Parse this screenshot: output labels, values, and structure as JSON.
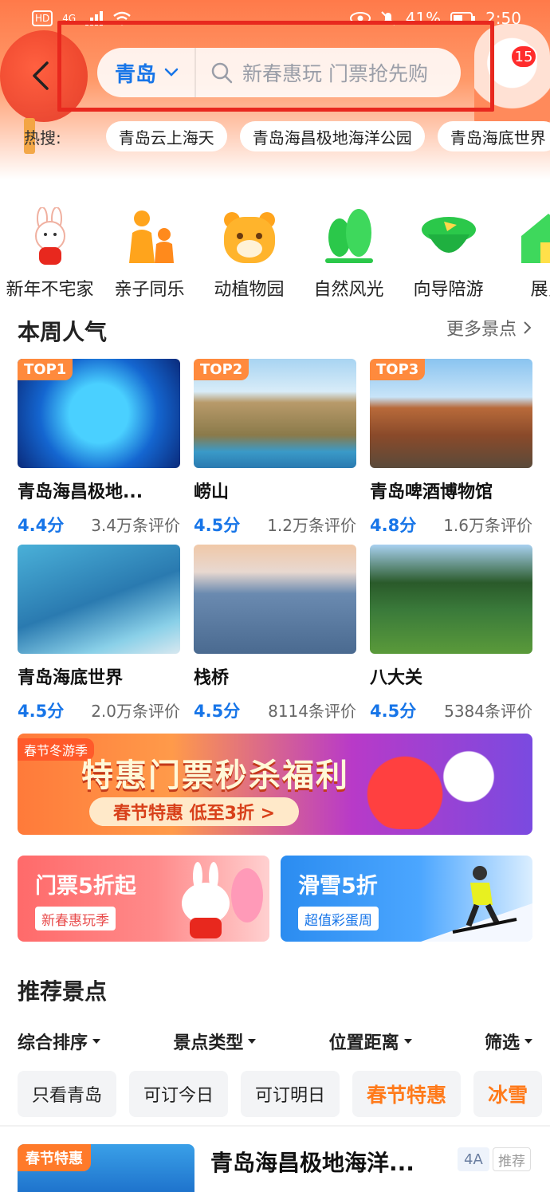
{
  "status_bar": {
    "network": "4G",
    "battery": "41%",
    "time": "2:50"
  },
  "header": {
    "city": "青岛",
    "search_placeholder": "新春惠玩 门票抢先购",
    "message_count": "15"
  },
  "hot_search": {
    "label": "热搜:",
    "items": [
      "青岛云上海天",
      "青岛海昌极地海洋公园",
      "青岛海底世界"
    ]
  },
  "categories": [
    {
      "label": "新年不宅家",
      "icon": "rabbit-icon"
    },
    {
      "label": "亲子同乐",
      "icon": "family-icon"
    },
    {
      "label": "动植物园",
      "icon": "tiger-icon"
    },
    {
      "label": "自然风光",
      "icon": "tree-icon"
    },
    {
      "label": "向导陪游",
      "icon": "guide-hat-icon"
    },
    {
      "label": "展览",
      "icon": "house-icon"
    }
  ],
  "weekly": {
    "title": "本周人气",
    "more": "更多景点",
    "items": [
      {
        "tag": "TOP1",
        "name": "青岛海昌极地...",
        "score": "4.4分",
        "reviews": "3.4万条评价"
      },
      {
        "tag": "TOP2",
        "name": "崂山",
        "score": "4.5分",
        "reviews": "1.2万条评价"
      },
      {
        "tag": "TOP3",
        "name": "青岛啤酒博物馆",
        "score": "4.8分",
        "reviews": "1.6万条评价"
      },
      {
        "tag": "",
        "name": "青岛海底世界",
        "score": "4.5分",
        "reviews": "2.0万条评价"
      },
      {
        "tag": "",
        "name": "栈桥",
        "score": "4.5分",
        "reviews": "8114条评价"
      },
      {
        "tag": "",
        "name": "八大关",
        "score": "4.5分",
        "reviews": "5384条评价"
      }
    ]
  },
  "banner": {
    "tag": "春节冬游季",
    "title": "特惠门票秒杀福利",
    "subtitle": "春节特惠 低至3折 >"
  },
  "promos": [
    {
      "title": "门票5折起",
      "sub": "新春惠玩季"
    },
    {
      "title": "滑雪5折",
      "sub": "超值彩蛋周"
    }
  ],
  "recommend": {
    "title": "推荐景点",
    "sorts": [
      "综合排序",
      "景点类型",
      "位置距离",
      "筛选"
    ],
    "filters": [
      "只看青岛",
      "可订今日",
      "可订明日",
      "春节特惠",
      "冰雪"
    ],
    "first": {
      "tag": "春节特惠",
      "name": "青岛海昌极地海洋...",
      "level": "4A",
      "badge": "推荐"
    }
  }
}
